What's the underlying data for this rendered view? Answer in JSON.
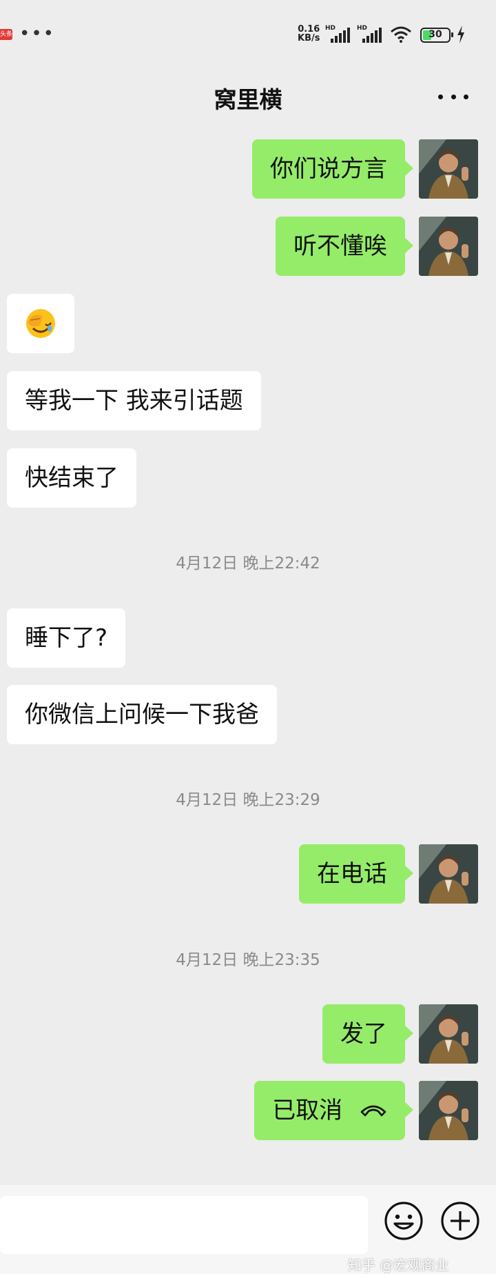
{
  "status_bar": {
    "app_badge": "头条",
    "more_indicator": "•••",
    "net_speed_value": "0.16",
    "net_speed_unit": "KB/s",
    "signal1_label": "HD",
    "signal2_label": "HD",
    "battery_level": "30",
    "icons": [
      "signal-icon",
      "wifi-icon",
      "battery-icon",
      "charging-icon"
    ]
  },
  "header": {
    "title": "窝里横",
    "more_icon": "more-icon"
  },
  "messages": [
    {
      "side": "out",
      "text": "你们说方言"
    },
    {
      "side": "out",
      "text": "听不懂唉"
    },
    {
      "side": "in",
      "type": "emoji",
      "emoji": "face-with-hand-over-eyes-laughing"
    },
    {
      "side": "in",
      "text": "等我一下 我来引话题"
    },
    {
      "side": "in",
      "text": "快结束了"
    },
    {
      "type": "time",
      "text": "4月12日 晚上22:42"
    },
    {
      "side": "in",
      "text": "睡下了?"
    },
    {
      "side": "in",
      "text": "你微信上问候一下我爸"
    },
    {
      "type": "time",
      "text": "4月12日 晚上23:29"
    },
    {
      "side": "out",
      "text": "在电话"
    },
    {
      "type": "time",
      "text": "4月12日 晚上23:35"
    },
    {
      "side": "out",
      "text": "发了"
    },
    {
      "side": "out",
      "text": "已取消",
      "icon": "hang-up-icon"
    }
  ],
  "input_bar": {
    "emoji_icon": "emoji-icon",
    "plus_icon": "plus-icon",
    "watermark": "知乎 @宏观商业"
  },
  "colors": {
    "background": "#ededed",
    "outgoing_bubble": "#95ec69",
    "incoming_bubble": "#ffffff",
    "timestamp_text": "#8a8a8a"
  }
}
